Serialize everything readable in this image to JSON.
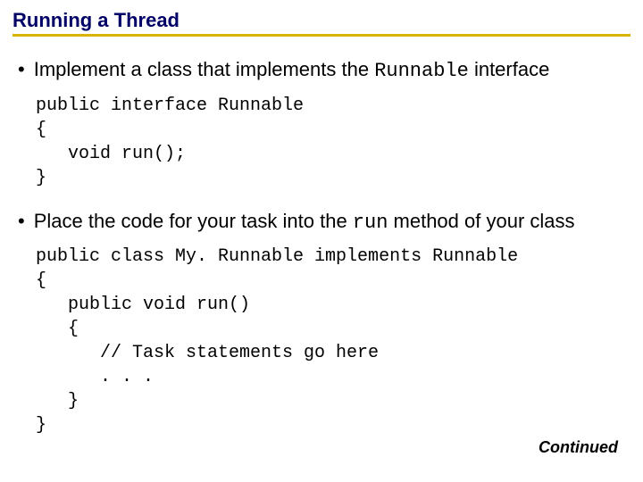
{
  "title": "Running a Thread",
  "bullets": [
    {
      "prefix": "Implement a class that implements the ",
      "code": "Runnable",
      "suffix": " interface"
    },
    {
      "prefix": "Place the code for your task into the ",
      "code": "run",
      "suffix": " method of your class"
    }
  ],
  "code_blocks": [
    "public interface Runnable\n{\n   void run();\n}",
    "public class My. Runnable implements Runnable\n{\n   public void run()\n   {\n      // Task statements go here\n      . . .\n   }\n}"
  ],
  "continued": "Continued"
}
